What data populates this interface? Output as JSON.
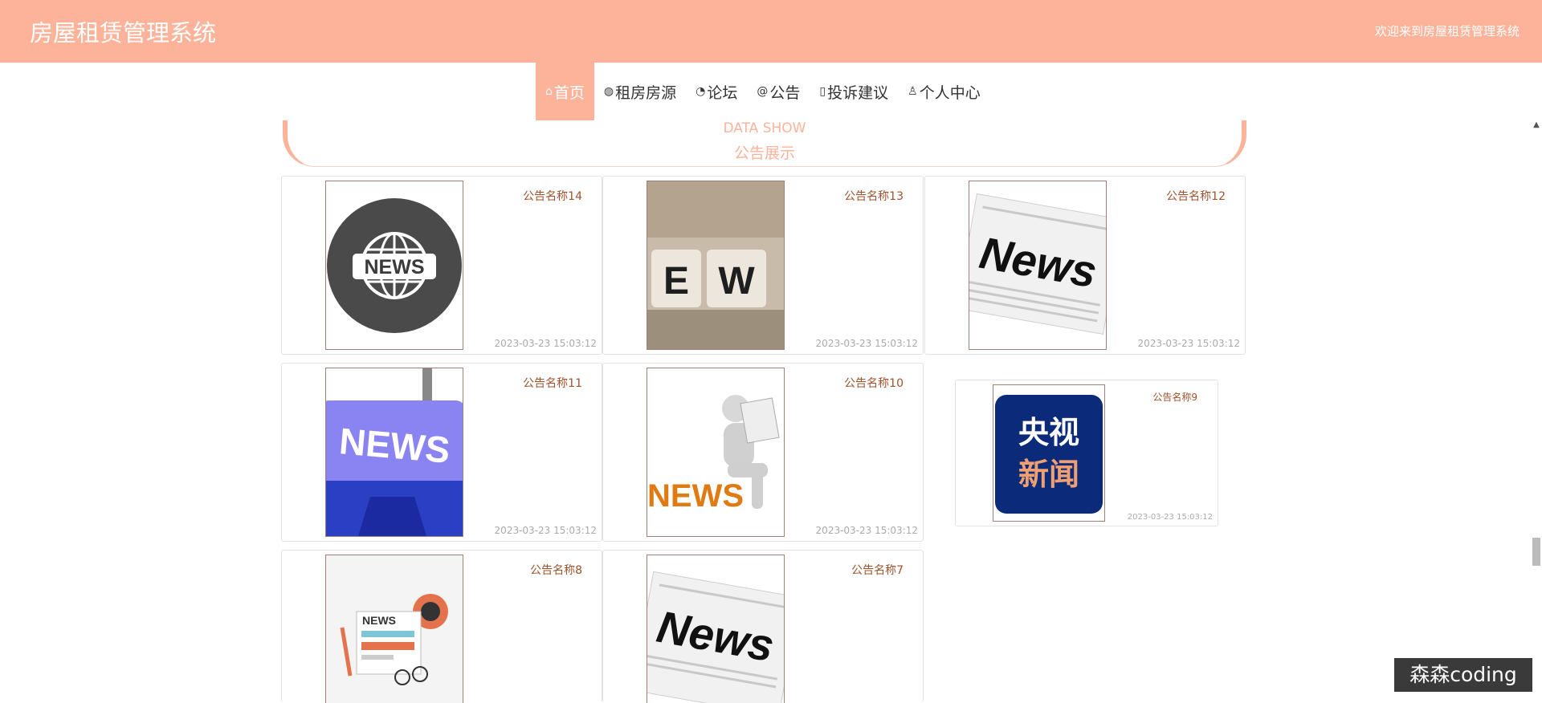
{
  "header": {
    "title": "房屋租赁管理系统",
    "welcome": "欢迎来到房屋租赁管理系统"
  },
  "nav": [
    {
      "label": "首页",
      "icon": "home-icon",
      "active": true
    },
    {
      "label": "租房房源",
      "icon": "globe-icon",
      "active": false
    },
    {
      "label": "论坛",
      "icon": "dashboard-icon",
      "active": false
    },
    {
      "label": "公告",
      "icon": "at-icon",
      "active": false
    },
    {
      "label": "投诉建议",
      "icon": "note-icon",
      "active": false
    },
    {
      "label": "个人中心",
      "icon": "user-icon",
      "active": false
    }
  ],
  "section": {
    "en_title": "DATA SHOW",
    "zh_title": "公告展示"
  },
  "notices": [
    {
      "name": "公告名称14",
      "date": "2023-03-23 15:03:12",
      "image": "globe-news-icon"
    },
    {
      "name": "公告名称13",
      "date": "2023-03-23 15:03:12",
      "image": "letter-dice-news-icon"
    },
    {
      "name": "公告名称12",
      "date": "2023-03-23 15:03:12",
      "image": "newspaper-news-icon"
    },
    {
      "name": "公告名称11",
      "date": "2023-03-23 15:03:12",
      "image": "news-keyboard-key-icon"
    },
    {
      "name": "公告名称10",
      "date": "2023-03-23 15:03:12",
      "image": "reader-figure-news-icon"
    },
    {
      "name": "公告名称9",
      "date": "2023-03-23 15:03:12",
      "image": "cctv-news-logo-icon",
      "logo_text": "央视新闻"
    },
    {
      "name": "公告名称8",
      "date": "",
      "image": "news-desk-illustration-icon"
    },
    {
      "name": "公告名称7",
      "date": "",
      "image": "newspaper-news-icon"
    }
  ],
  "watermark": "森森coding",
  "colors": {
    "accent": "#fdb39a",
    "name_text": "#a0522d",
    "date_text": "#aaaaaa"
  }
}
